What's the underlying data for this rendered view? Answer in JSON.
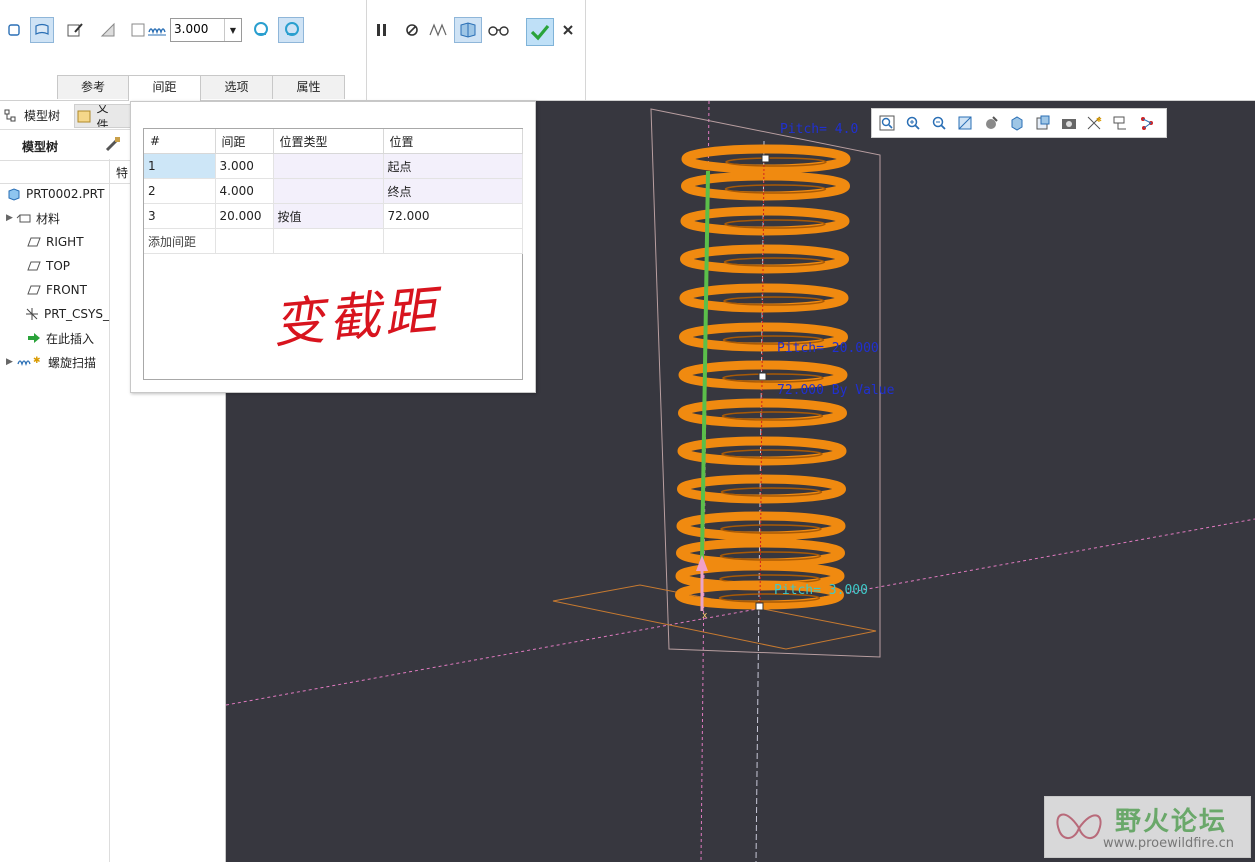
{
  "ribbon": {
    "pitch_value": "3.000"
  },
  "dash_tabs": [
    "参考",
    "间距",
    "选项",
    "属性"
  ],
  "tree": {
    "tab_model_tree": "模型树",
    "tab_files": "文件...",
    "header_title": "模型树",
    "column_header": "特",
    "items": [
      "PRT0002.PRT",
      "材料",
      "RIGHT",
      "TOP",
      "FRONT",
      "PRT_CSYS_",
      "在此插入",
      "螺旋扫描"
    ]
  },
  "pitch_table": {
    "columns": [
      "#",
      "间距",
      "位置类型",
      "位置"
    ],
    "rows": [
      {
        "idx": "1",
        "pitch": "3.000",
        "type": "",
        "location": "起点"
      },
      {
        "idx": "2",
        "pitch": "4.000",
        "type": "",
        "location": "终点"
      },
      {
        "idx": "3",
        "pitch": "20.000",
        "type": "按值",
        "location": "72.000"
      }
    ],
    "add_row": "添加间距"
  },
  "annotation_text": "变截距",
  "viewport_labels": {
    "pitch_top": "Pitch= 4.0",
    "pitch_mid": "Pitch= 20.000",
    "by_value": "72.000 By Value",
    "pitch_bottom": "Pitch= 3.000"
  },
  "watermark": {
    "brand": "野火论坛",
    "url": "www.proewildfire.cn"
  },
  "colors": {
    "viewport_bg": "#37373f",
    "spring": "#f08a10",
    "axis_green": "#5bbf4a",
    "label_blue": "#2030d0",
    "label_cyan": "#3fc8c8",
    "annotation_red": "#d8141e",
    "ok_green": "#2aa33a"
  }
}
